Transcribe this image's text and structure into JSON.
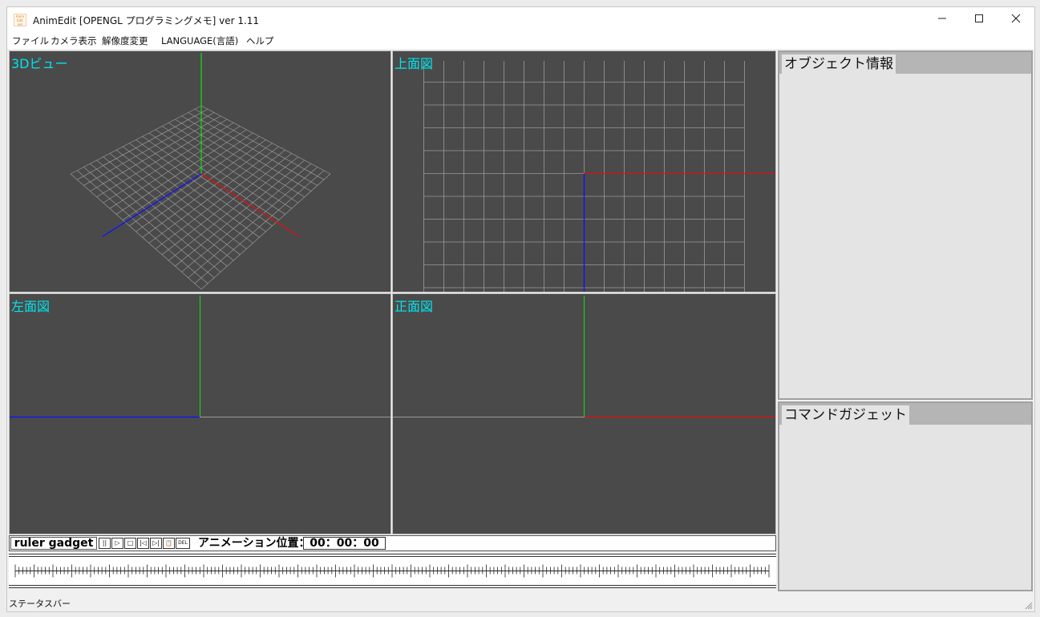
{
  "window": {
    "title": "AnimEdit [OPENGL プログラミングメモ] ver 1.11",
    "icon_text": "Anim Edit ver",
    "icon": "animedit-app-icon",
    "minimize_icon": "minimize-icon",
    "maximize_icon": "maximize-icon",
    "close_icon": "close-icon"
  },
  "menu": {
    "items": [
      "ファイル",
      "カメラ表示",
      "解像度変更",
      "LANGUAGE(言語)",
      "ヘルプ"
    ]
  },
  "viewports": {
    "perspective": {
      "label": "3Dビュー"
    },
    "top": {
      "label": "上面図"
    },
    "left": {
      "label": "左面図"
    },
    "front": {
      "label": "正面図"
    }
  },
  "panels": {
    "object_info": {
      "title": "オブジェクト情報"
    },
    "command_gadget": {
      "title": "コマンドガジェット"
    }
  },
  "ruler": {
    "title": "ruler gadget",
    "buttons": [
      {
        "name": "pause-icon",
        "label": "||"
      },
      {
        "name": "play-icon",
        "label": "▷"
      },
      {
        "name": "stop-icon",
        "label": "□"
      },
      {
        "name": "prev-frame-icon",
        "label": "|◁"
      },
      {
        "name": "next-frame-icon",
        "label": "▷|"
      },
      {
        "name": "clipboard-icon",
        "label": "📋"
      },
      {
        "name": "delete-icon",
        "label": "DEL"
      }
    ],
    "position_label": "アニメーション位置：",
    "position_value": "00：00：00"
  },
  "status": {
    "text": "ステータスバー"
  },
  "colors": {
    "viewport_bg": "#4a4a4a",
    "label": "#00e5ee",
    "grid": "#9a9a9a",
    "axis_x": "#e01010",
    "axis_y": "#10e010",
    "axis_z": "#1010ff"
  }
}
